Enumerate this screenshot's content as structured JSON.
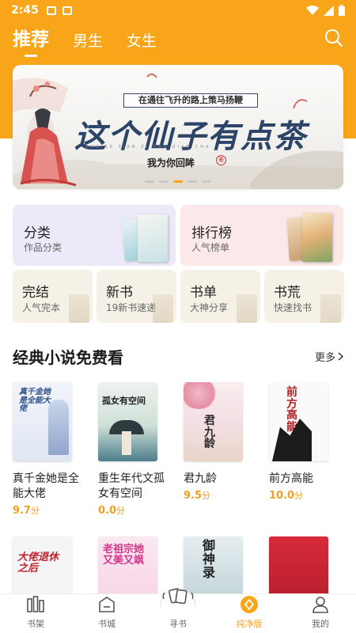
{
  "status_bar": {
    "time": "2:45"
  },
  "tabs": [
    {
      "label": "推荐",
      "active": true
    },
    {
      "label": "男生",
      "active": false
    },
    {
      "label": "女生",
      "active": false
    }
  ],
  "search": {
    "icon": "search-icon"
  },
  "banner": {
    "tagline": "在通往飞升的路上策马扬鞭",
    "title": "这个仙子有点茶",
    "subtitle": "ZHE GE XIAN ZI YOU DIAN CHA",
    "author": "我为你回眸",
    "seal": "著",
    "dots": 5,
    "active_dot": 2
  },
  "entries": {
    "category": {
      "title": "分类",
      "sub": "作品分类"
    },
    "ranking": {
      "title": "排行榜",
      "sub": "人气榜单"
    },
    "finished": {
      "title": "完结",
      "sub": "人气完本"
    },
    "new_books": {
      "title": "新书",
      "sub": "19新书速递"
    },
    "book_list": {
      "title": "书单",
      "sub": "大神分享"
    },
    "book_hunt": {
      "title": "书荒",
      "sub": "快速找书"
    }
  },
  "section": {
    "title": "经典小说免费看",
    "more": "更多"
  },
  "books": [
    {
      "title": "真千金她是全能大佬",
      "score": "9.7",
      "unit": "分",
      "cover_text": "真千金她是全能大佬"
    },
    {
      "title": "重生年代文孤女有空间",
      "score": "0.0",
      "unit": "分",
      "cover_text": "孤女有空间"
    },
    {
      "title": "君九龄",
      "score": "9.5",
      "unit": "分",
      "cover_text": "君九龄"
    },
    {
      "title": "前方高能",
      "score": "10.0",
      "unit": "分",
      "cover_text": "前方高能"
    }
  ],
  "books_row2": [
    {
      "cover_text": "大佬退休之后"
    },
    {
      "cover_text": "老祖宗她又美又飒"
    },
    {
      "cover_text": "御神录"
    },
    {
      "cover_text": ""
    }
  ],
  "bottom_nav": [
    {
      "label": "书架",
      "icon": "bookshelf-icon"
    },
    {
      "label": "书城",
      "icon": "bookstore-icon"
    },
    {
      "label": "寻书",
      "icon": "find-book-icon"
    },
    {
      "label": "纯净版",
      "icon": "pure-mode-icon",
      "active": true
    },
    {
      "label": "我的",
      "icon": "profile-icon"
    }
  ],
  "colors": {
    "accent": "#f9a51a",
    "category_bg": "#eceaf8",
    "ranking_bg": "#fbe9ea",
    "small_card_bg": "#f6f1e6"
  }
}
